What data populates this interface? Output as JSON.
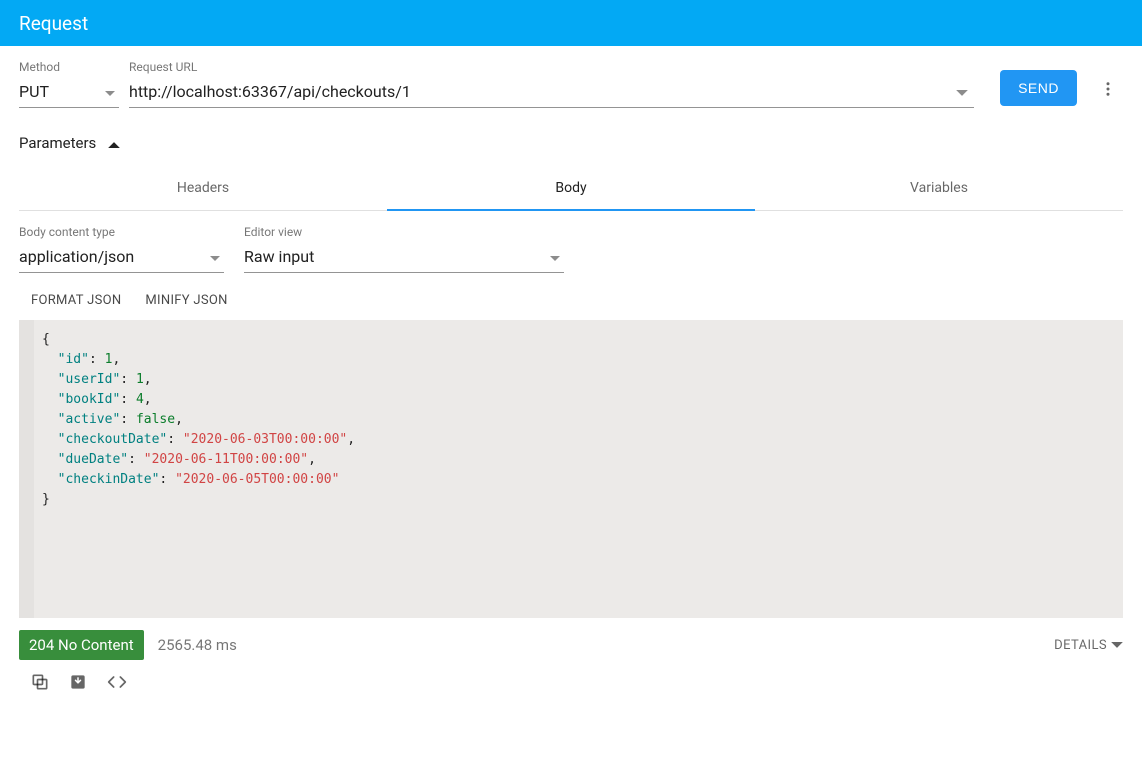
{
  "header": {
    "title": "Request"
  },
  "method": {
    "label": "Method",
    "value": "PUT"
  },
  "url": {
    "label": "Request URL",
    "value": "http://localhost:63367/api/checkouts/1"
  },
  "send_label": "SEND",
  "parameters_label": "Parameters",
  "tabs": {
    "headers": "Headers",
    "body": "Body",
    "variables": "Variables"
  },
  "body_content_type": {
    "label": "Body content type",
    "value": "application/json"
  },
  "editor_view": {
    "label": "Editor view",
    "value": "Raw input"
  },
  "json_actions": {
    "format": "FORMAT JSON",
    "minify": "MINIFY JSON"
  },
  "body_payload": {
    "id": 1,
    "userId": 1,
    "bookId": 4,
    "active": false,
    "checkoutDate": "2020-06-03T00:00:00",
    "dueDate": "2020-06-11T00:00:00",
    "checkinDate": "2020-06-05T00:00:00"
  },
  "response": {
    "status_text": "204 No Content",
    "timing": "2565.48 ms",
    "details_label": "DETAILS"
  }
}
